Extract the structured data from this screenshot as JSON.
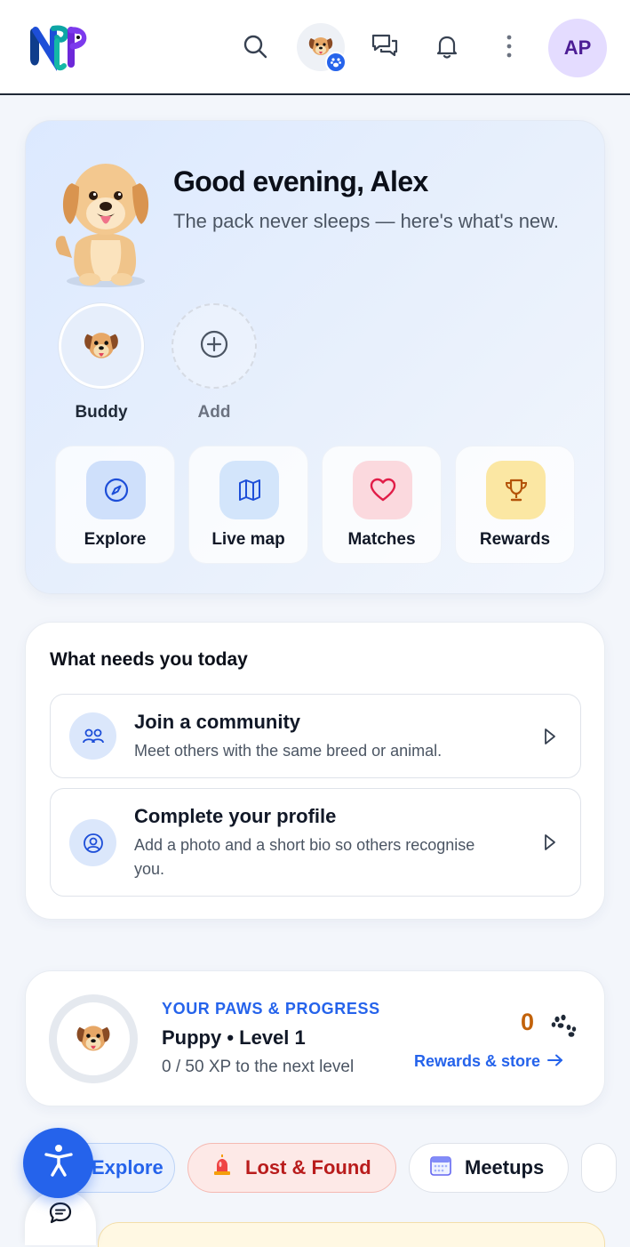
{
  "header": {
    "logo_alt": "NFP",
    "avatar_initials": "AP",
    "icons": [
      "search-icon",
      "pet-switcher",
      "messages-icon",
      "bell-icon",
      "more-icon"
    ]
  },
  "hero": {
    "greeting": "Good evening, Alex",
    "subtitle": "The pack never sleeps — here's what's new.",
    "pets": [
      {
        "name": "Buddy"
      },
      {
        "name": "Add"
      }
    ],
    "tiles": [
      {
        "label": "Explore",
        "icon": "compass-icon",
        "color": "#cfe0fb"
      },
      {
        "label": "Live map",
        "icon": "map-icon",
        "color": "#d3e5fb"
      },
      {
        "label": "Matches",
        "icon": "heart-icon",
        "color": "#fbd9de"
      },
      {
        "label": "Rewards",
        "icon": "trophy-icon",
        "color": "#fbe7a3"
      }
    ]
  },
  "today": {
    "title": "What needs you today",
    "tasks": [
      {
        "title": "Join a community",
        "desc": "Meet others with the same breed or animal.",
        "icon": "people-icon"
      },
      {
        "title": "Complete your profile",
        "desc": "Add a photo and a short bio so others recognise you.",
        "icon": "user-circle-icon"
      }
    ]
  },
  "progress": {
    "eyebrow": "YOUR PAWS & PROGRESS",
    "level": "Puppy • Level 1",
    "xp": "0 / 50 XP to the next level",
    "xp_current": 0,
    "xp_target": 50,
    "paws": "0",
    "link": "Rewards & store"
  },
  "chips": [
    {
      "label": "Explore"
    },
    {
      "label": "Lost & Found",
      "icon": "siren-icon"
    },
    {
      "label": "Meetups",
      "icon": "calendar-icon"
    }
  ],
  "colors": {
    "accent": "#2563eb",
    "paws": "#c2620a",
    "lost": "#b91c1c"
  }
}
